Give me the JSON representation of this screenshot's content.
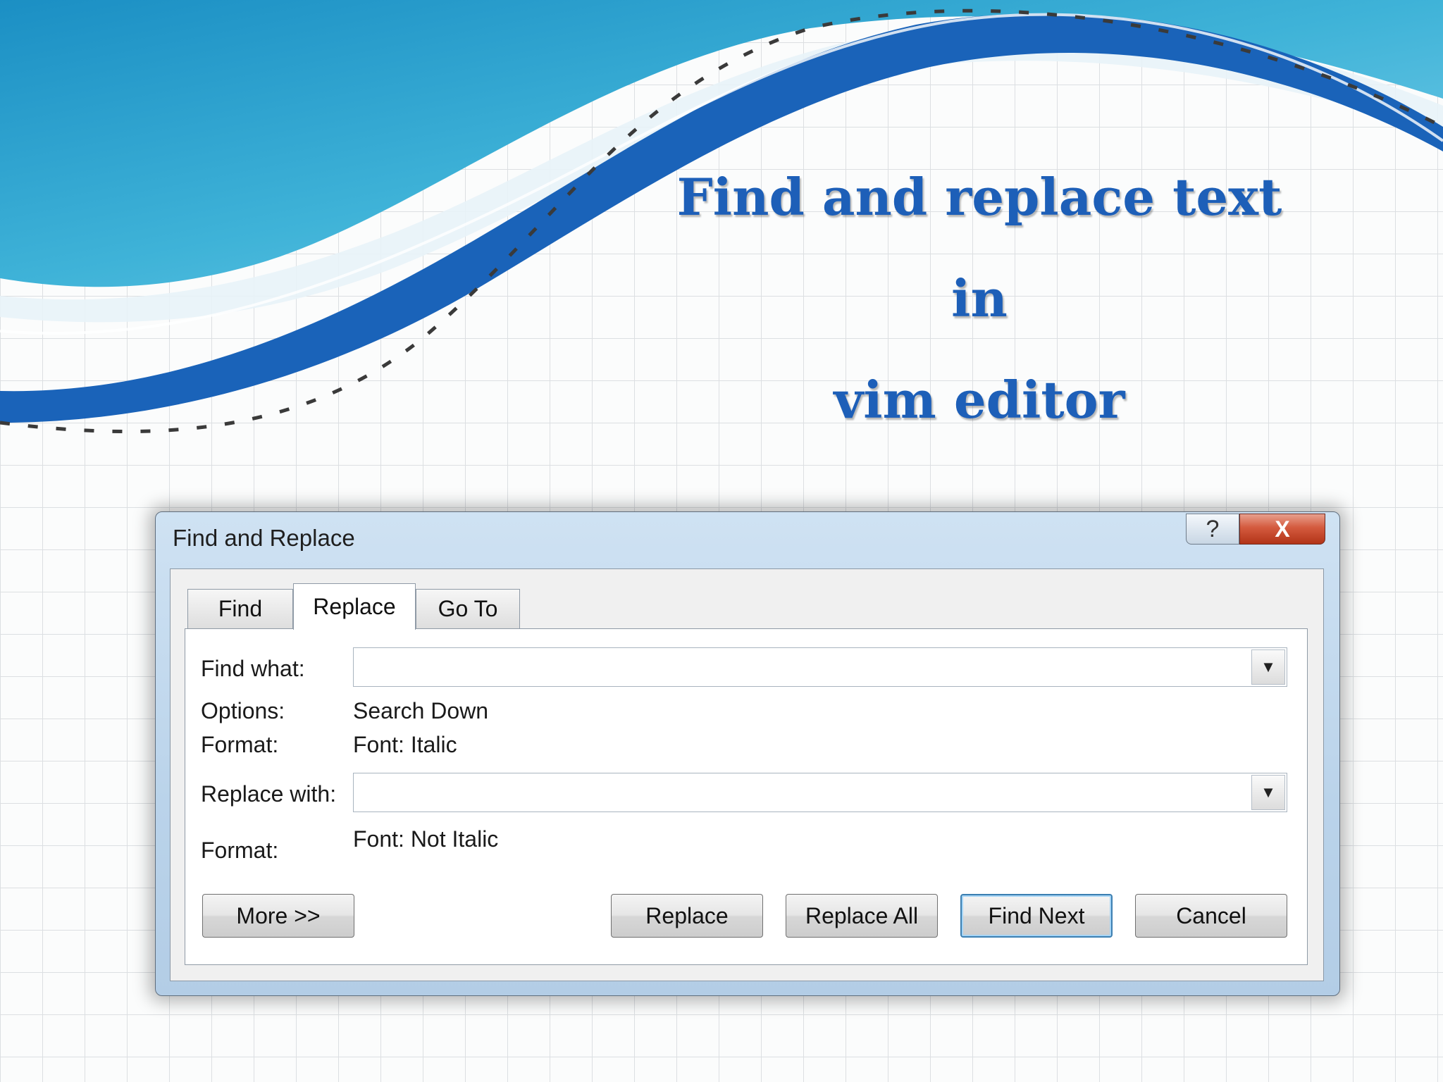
{
  "slide": {
    "title_lines": [
      "Find and replace text",
      "in",
      "vim editor"
    ]
  },
  "dialog": {
    "title": "Find and Replace",
    "help_glyph": "?",
    "close_glyph": "X",
    "tabs": [
      {
        "label": "Find",
        "active": false
      },
      {
        "label": "Replace",
        "active": true
      },
      {
        "label": "Go To",
        "active": false
      }
    ],
    "find_what_label": "Find what:",
    "find_what_value": "",
    "options_label": "Options:",
    "options_value": "Search Down",
    "find_format_label": "Format:",
    "find_format_value": "Font: Italic",
    "replace_with_label": "Replace with:",
    "replace_with_value": "",
    "replace_format_label": "Format:",
    "replace_format_value": "Font: Not Italic",
    "buttons": {
      "more": "More >>",
      "replace": "Replace",
      "replace_all": "Replace All",
      "find_next": "Find Next",
      "cancel": "Cancel"
    }
  },
  "colors": {
    "title_text": "#1d5fb8",
    "swoosh_dark": "#1a63b9",
    "swoosh_light": "#3fb3d8",
    "close_button": "#c8452a"
  },
  "icons": {
    "dropdown": "triangle-down",
    "help": "question-mark",
    "close": "x-mark"
  }
}
